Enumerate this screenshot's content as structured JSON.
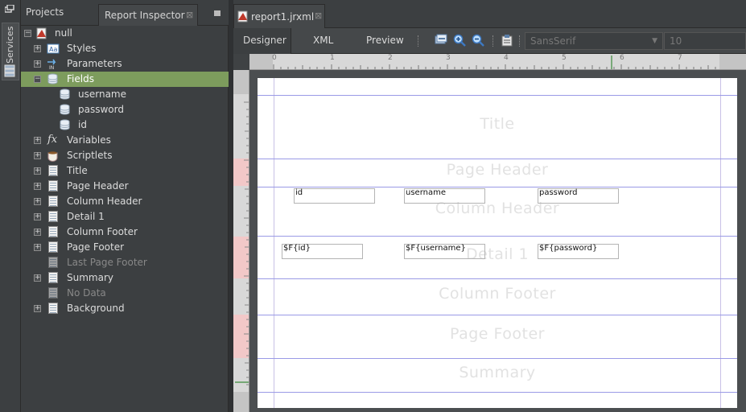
{
  "services": {
    "label": "Services"
  },
  "left_tabs": {
    "projects": "Projects",
    "report_inspector": "Report Inspector"
  },
  "tree": {
    "root": "null",
    "items": [
      {
        "label": "Styles",
        "expander": "+",
        "icon": "styles-icon"
      },
      {
        "label": "Parameters",
        "expander": "+",
        "icon": "parameters-icon"
      },
      {
        "label": "Fields",
        "expander": "−",
        "icon": "fields-icon",
        "selected": true
      },
      {
        "label": "username",
        "icon": "field-icon"
      },
      {
        "label": "password",
        "icon": "field-icon"
      },
      {
        "label": "id",
        "icon": "field-icon"
      },
      {
        "label": "Variables",
        "expander": "+",
        "icon": "variables-icon"
      },
      {
        "label": "Scriptlets",
        "expander": "+",
        "icon": "scriptlets-icon"
      },
      {
        "label": "Title",
        "expander": "+",
        "icon": "band-icon"
      },
      {
        "label": "Page Header",
        "expander": "+",
        "icon": "band-icon"
      },
      {
        "label": "Column Header",
        "expander": "+",
        "icon": "band-icon"
      },
      {
        "label": "Detail 1",
        "expander": "+",
        "icon": "band-icon"
      },
      {
        "label": "Column Footer",
        "expander": "+",
        "icon": "band-icon"
      },
      {
        "label": "Page Footer",
        "expander": "+",
        "icon": "band-icon"
      },
      {
        "label": "Last Page Footer",
        "icon": "band-icon",
        "disabled": true
      },
      {
        "label": "Summary",
        "expander": "+",
        "icon": "band-icon"
      },
      {
        "label": "No Data",
        "icon": "band-icon",
        "disabled": true
      },
      {
        "label": "Background",
        "expander": "+",
        "icon": "band-icon"
      }
    ]
  },
  "editor": {
    "file_tab": "report1.jrxml",
    "tabs": {
      "designer": "Designer",
      "xml": "XML",
      "preview": "Preview"
    },
    "font_family": "SansSerif",
    "font_size": "10"
  },
  "ruler": {
    "labels": [
      "0",
      "1",
      "2",
      "3",
      "4",
      "5",
      "6",
      "7"
    ]
  },
  "bands": {
    "title": "Title",
    "page_header": "Page Header",
    "column_header": "Column Header",
    "detail": "Detail 1",
    "column_footer": "Column Footer",
    "page_footer": "Page Footer",
    "summary": "Summary"
  },
  "column_header_fields": {
    "id": "id",
    "username": "username",
    "password": "password"
  },
  "detail_fields": {
    "id": "$F{id}",
    "username": "$F{username}",
    "password": "$F{password}"
  }
}
